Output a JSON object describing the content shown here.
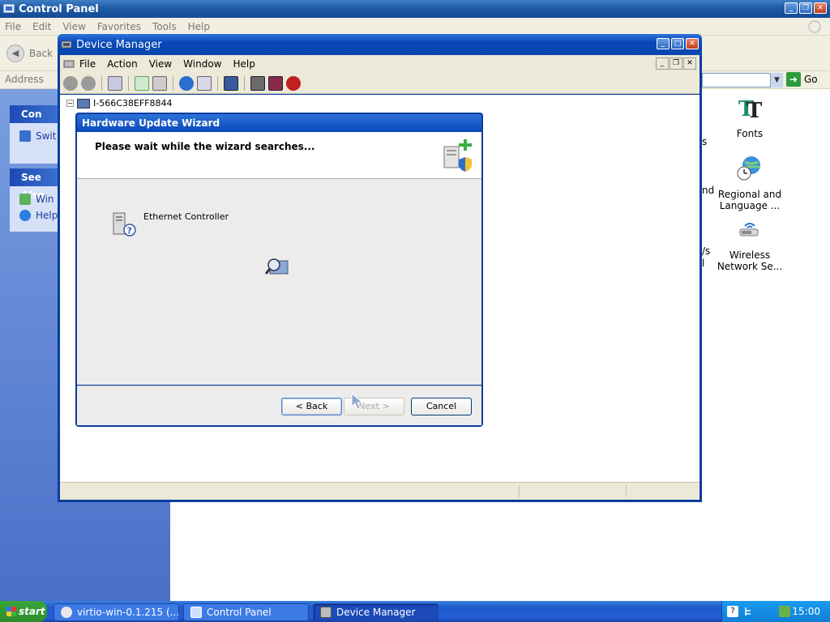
{
  "control_panel": {
    "title": "Control Panel",
    "menu": [
      "File",
      "Edit",
      "View",
      "Favorites",
      "Tools",
      "Help"
    ],
    "back_label": "Back",
    "address_label": "Address",
    "go_label": "Go",
    "sidebar": {
      "panel1_head": "Con",
      "panel1_items": [
        "Swit"
      ],
      "panel2_head": "See Also",
      "panel2_items": [
        "Win",
        "Help"
      ]
    },
    "icons": [
      {
        "label": "Fonts",
        "icon": "fonts-icon"
      },
      {
        "label": "Regional and Language ...",
        "icon": "globe-clock-icon"
      },
      {
        "label": "Wireless Network Se...",
        "icon": "wireless-icon"
      }
    ],
    "cut_labels": [
      "s",
      "nd",
      "/s",
      "l"
    ]
  },
  "device_manager": {
    "title": "Device Manager",
    "menu": [
      "File",
      "Action",
      "View",
      "Window",
      "Help"
    ],
    "tree_root": "I-566C38EFF8844"
  },
  "wizard": {
    "title": "Hardware Update Wizard",
    "header_text": "Please wait while the wizard searches...",
    "device_name": "Ethernet Controller",
    "back_label": "< Back",
    "next_label": "Next >",
    "cancel_label": "Cancel"
  },
  "taskbar": {
    "start_label": "start",
    "tasks": [
      {
        "label": "virtio-win-0.1.215 (...",
        "active": false
      },
      {
        "label": "Control Panel",
        "active": false
      },
      {
        "label": "Device Manager",
        "active": true
      }
    ],
    "clock": "15:00"
  },
  "colors": {
    "xp_blue": "#0a48b8",
    "start_green": "#3aa63a",
    "wizard_bg": "#ececec"
  }
}
